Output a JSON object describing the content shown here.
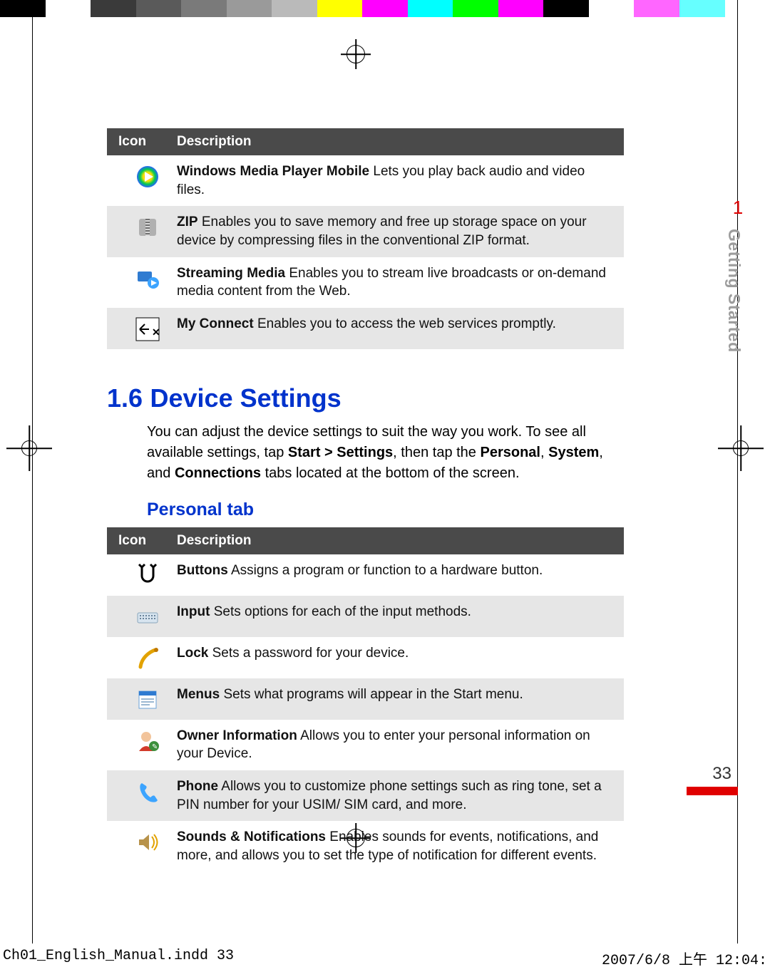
{
  "colorbar": [
    "#000000",
    "#ffffff",
    "#3a3a3a",
    "#5a5a5a",
    "#7a7a7a",
    "#9a9a9a",
    "#bababa",
    "#ffff00",
    "#ff00ff",
    "#00ffff",
    "#00ff00",
    "#ff00ff",
    "#000000",
    "#ffffff",
    "#ff66ff",
    "#66ffff",
    "#ffffff"
  ],
  "chapter": {
    "number": "1",
    "title": "Getting Started"
  },
  "table_header": {
    "icon": "Icon",
    "description": "Description"
  },
  "programs_table": [
    {
      "bold": "Windows Media Player Mobile",
      "rest": "  Lets you play back audio and video files.",
      "icon": "wmp-icon",
      "alt": false
    },
    {
      "bold": "ZIP",
      "rest": "  Enables you to save memory and free up storage space on your device by compressing files in the conventional ZIP format.",
      "icon": "zip-icon",
      "alt": true
    },
    {
      "bold": "Streaming Media",
      "rest": "  Enables you to stream live broadcasts or on-demand media content from the Web.",
      "icon": "streaming-icon",
      "alt": false
    },
    {
      "bold": "My Connect",
      "rest": "  Enables you to access the web services promptly.",
      "icon": "myconnect-icon",
      "alt": true
    }
  ],
  "section": {
    "number": "1.6",
    "title": "Device Settings",
    "intro_parts": [
      "You can adjust the device settings to suit the way you work. To see all available settings, tap ",
      "Start > Settings",
      ", then tap the ",
      "Personal",
      ", ",
      "System",
      ", and ",
      "Connections",
      " tabs located at the bottom of the screen."
    ]
  },
  "subhead": "Personal tab",
  "personal_table": [
    {
      "bold": "Buttons",
      "rest": "  Assigns a program or function to a hardware button.",
      "icon": "buttons-icon",
      "alt": false
    },
    {
      "bold": "Input",
      "rest": "  Sets options for each of the input methods.",
      "icon": "input-icon",
      "alt": true
    },
    {
      "bold": "Lock",
      "rest": "  Sets a password for your device.",
      "icon": "lock-icon",
      "alt": false
    },
    {
      "bold": "Menus",
      "rest": "  Sets what programs will appear in the Start menu.",
      "icon": "menus-icon",
      "alt": true
    },
    {
      "bold": "Owner Information",
      "rest": "  Allows you to enter your personal information on your Device.",
      "icon": "owner-icon",
      "alt": false
    },
    {
      "bold": "Phone",
      "rest": "  Allows you to customize phone settings such as ring tone, set a PIN number for your USIM/ SIM card, and more.",
      "icon": "phone-icon",
      "alt": true
    },
    {
      "bold": "Sounds & Notifications",
      "rest": "  Enables sounds for events, notifications, and more, and allows you to set the type of notification for different events.",
      "icon": "sounds-icon",
      "alt": false
    }
  ],
  "page_number": "33",
  "footer": {
    "left": "Ch01_English_Manual.indd   33",
    "right": "2007/6/8   上午 12:04:"
  }
}
